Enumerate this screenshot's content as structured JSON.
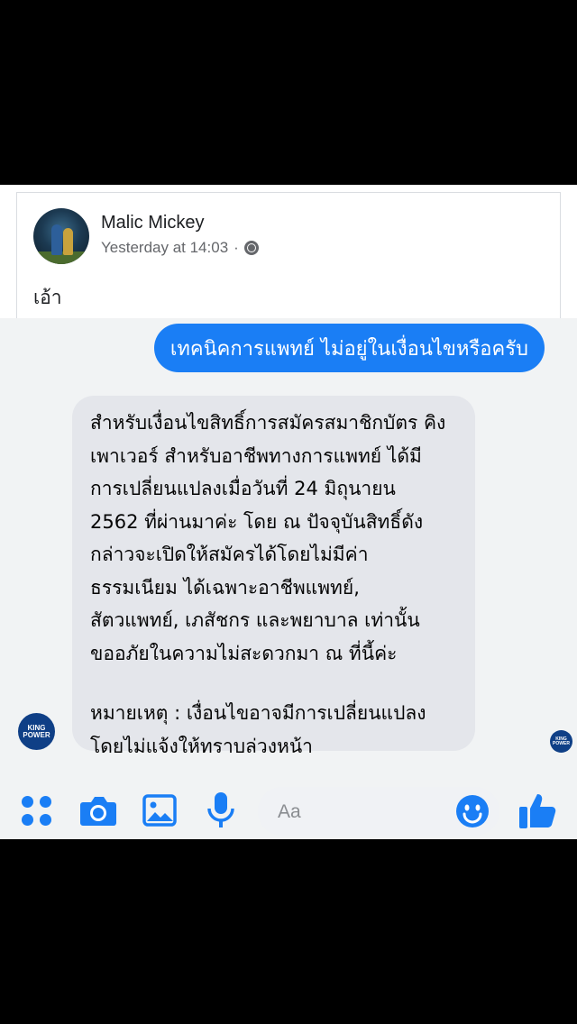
{
  "post": {
    "author": "Malic Mickey",
    "timestamp": "Yesterday at 14:03",
    "separator": "·",
    "text": "เอ้า",
    "privacy_icon": "globe-icon"
  },
  "chat": {
    "outgoing_message": "เทคนิคการแพทย์ ไม่อยู่ในเงื่อนไขหรือครับ",
    "incoming_message": "สำหรับเงื่อนไขสิทธิ์การสมัครสมาชิกบัตร คิง\nเพาเวอร์ สำหรับอาชีพทางการแพทย์ ได้มี\nการเปลี่ยนแปลงเมื่อวันที่ 24 มิถุนายน\n2562 ที่ผ่านมาค่ะ โดย ณ ปัจจุบันสิทธิ์ดัง\nกล่าวจะเปิดให้สมัครได้โดยไม่มีค่า\nธรรมเนียม ได้เฉพาะอาชีพแพทย์,\nสัตวแพทย์, เภสัชกร และพยาบาล เท่านั้น\nขออภัยในความไม่สะดวกมา ณ ที่นี้ค่ะ",
    "incoming_note": "หมายเหตุ : เงื่อนไขอาจมีการเปลี่ยนแปลง\nโดยไม่แจ้งให้ทราบล่วงหน้า",
    "sender_avatar": {
      "line1": "KING",
      "line2": "POWER"
    },
    "seen_avatar": {
      "line1": "KING",
      "line2": "POWER"
    }
  },
  "composer": {
    "placeholder": "Aa",
    "icons": [
      "apps-icon",
      "camera-icon",
      "photo-icon",
      "mic-icon",
      "emoji-icon",
      "like-icon"
    ]
  },
  "colors": {
    "messenger_blue": "#1a7ef5",
    "bubble_gray": "#e4e6eb",
    "king_power_navy": "#0f3f86"
  }
}
